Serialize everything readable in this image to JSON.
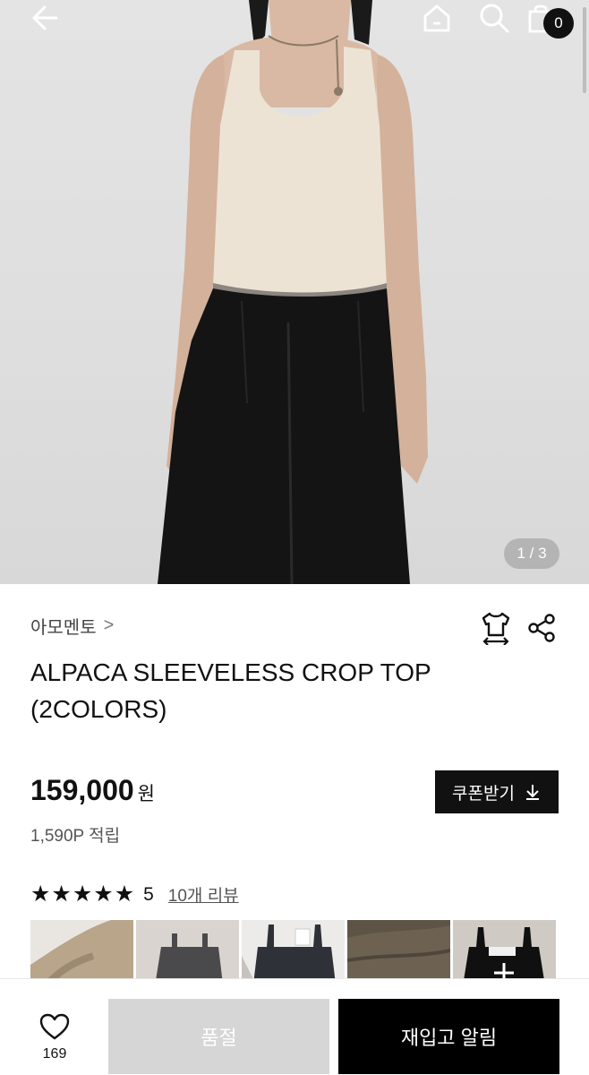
{
  "header": {
    "back_icon": "arrow-left-icon",
    "home_icon": "home-icon",
    "search_icon": "search-icon",
    "cart_icon": "shopping-bag-icon",
    "cart_count": "0"
  },
  "gallery": {
    "page_indicator": "1 / 3"
  },
  "product": {
    "brand": "아모멘토",
    "brand_chevron": ">",
    "title": "ALPACA SLEEVELESS CROP TOP (2COLORS)",
    "price": "159,000",
    "price_unit": "원",
    "points": "1,590P 적립",
    "coupon_label": "쿠폰받기",
    "size_icon": "size-guide-icon",
    "share_icon": "share-icon"
  },
  "reviews": {
    "stars": [
      "★",
      "★",
      "★",
      "★",
      "★"
    ],
    "rating": "5",
    "review_link": "10개 리뷰"
  },
  "bottom_bar": {
    "like_icon": "heart-icon",
    "like_count": "169",
    "sold_out_label": "품절",
    "restock_label": "재입고 알림"
  },
  "colors": {
    "primary": "#000000",
    "disabled": "#d6d6d6",
    "badge": "#111111"
  }
}
